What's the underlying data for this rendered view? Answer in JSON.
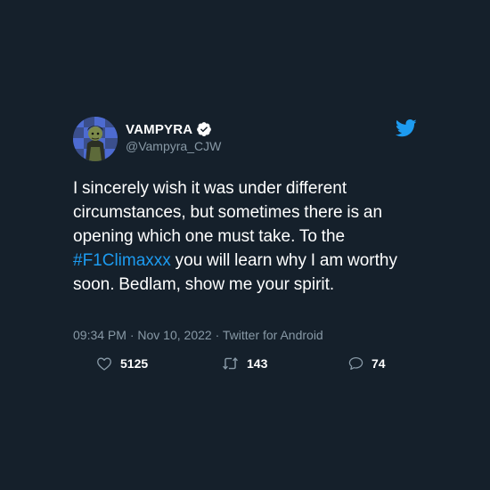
{
  "user": {
    "display_name": "VAMPYRA",
    "handle": "@Vampyra_CJW",
    "verified": true,
    "avatar_icon": "avatar-character-icon"
  },
  "tweet": {
    "text_before": "I sincerely wish it was under different circumstances, but sometimes there is an opening which one must take. To the ",
    "hashtag": "#F1Climaxxx",
    "text_after": " you will learn why I am worthy soon. Bedlam, show me your spirit."
  },
  "meta": {
    "time": "09:34 PM",
    "separator": "·",
    "date": "Nov 10, 2022",
    "client": "Twitter for Android"
  },
  "stats": {
    "likes": "5125",
    "retweets": "143",
    "replies": "74"
  },
  "colors": {
    "background": "#15202b",
    "accent": "#1d9bf0",
    "secondary_text": "#8899a6"
  }
}
